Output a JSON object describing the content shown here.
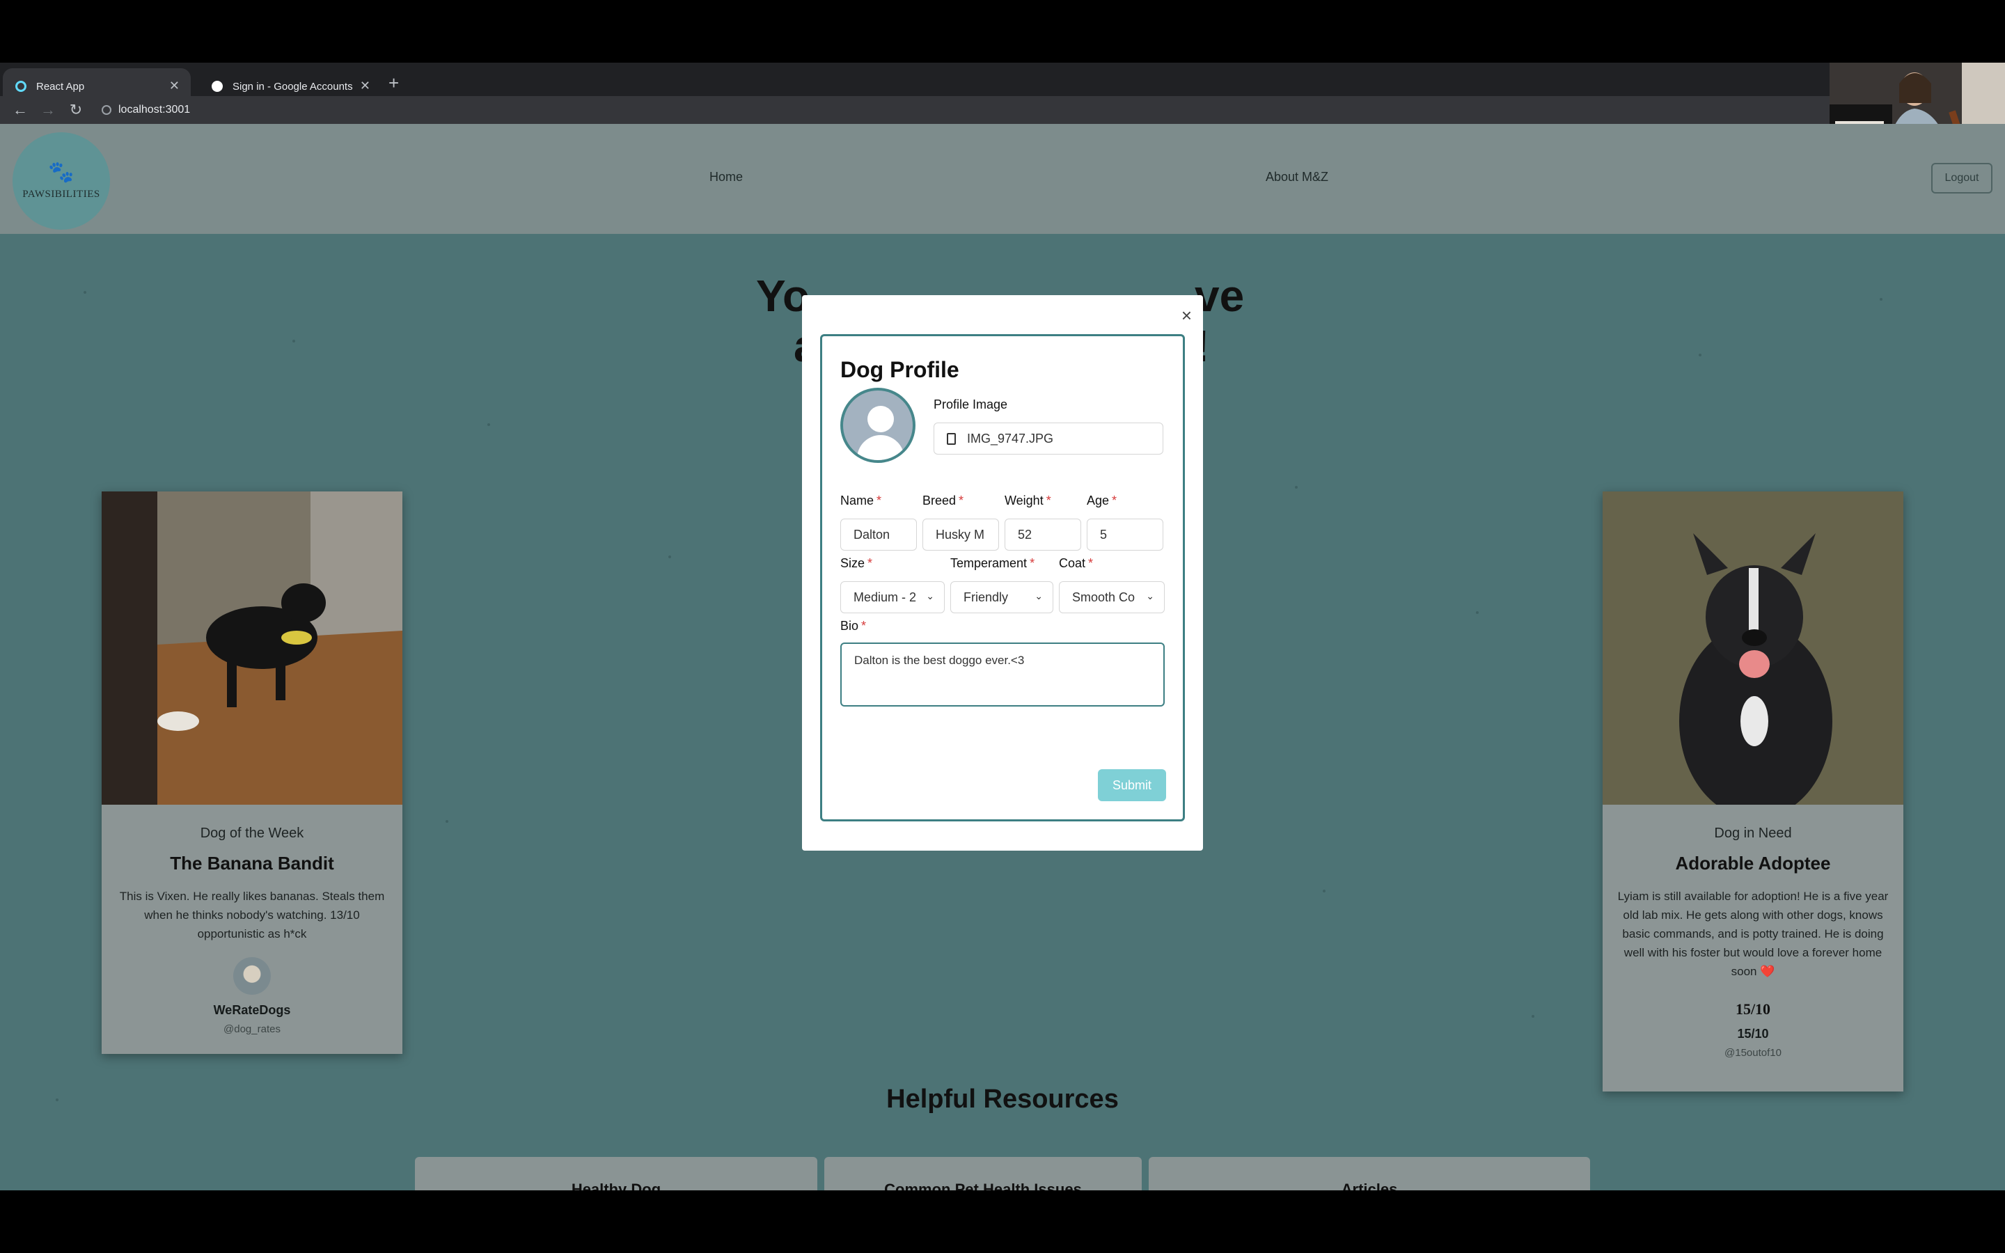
{
  "browser": {
    "tabs": [
      {
        "title": "React App",
        "favicon_color": "#61dafb"
      },
      {
        "title": "Sign in - Google Accounts",
        "favicon_color": "#ffffff"
      }
    ],
    "new_tab": "+",
    "back": "←",
    "forward": "→",
    "reload": "↻",
    "url": "localhost:3001"
  },
  "nav": {
    "logo_text": "PAWSIBILITIES",
    "logo_paw": "🐾",
    "links": [
      "Home",
      "About M&Z"
    ],
    "logout": "Logout"
  },
  "hero": {
    "fragment_l1": "Yo",
    "fragment_r1": "ve",
    "fragment_l2": "a",
    "fragment_r2": "!"
  },
  "dog_of_week": {
    "kicker": "Dog of the Week",
    "title": "The Banana Bandit",
    "body": "This is Vixen. He really likes bananas. Steals them when he thinks nobody's watching. 13/10 opportunistic as h*ck",
    "author": "WeRateDogs",
    "handle": "@dog_rates"
  },
  "dog_in_need": {
    "kicker": "Dog in Need",
    "title": "Adorable Adoptee",
    "body": "Lyiam is still available for adoption! He is a five year old lab mix. He gets along with other dogs, knows basic commands, and is potty trained. He is doing well with his foster but would love a forever home soon ❤️",
    "logo": "15/10",
    "author": "15/10",
    "handle": "@15outof10"
  },
  "resources": {
    "title": "Helpful Resources",
    "cards": [
      "Healthy Dog",
      "Common Pet Health Issues",
      "Articles"
    ]
  },
  "modal": {
    "close": "×",
    "title": "Dog Profile",
    "profile_image_label": "Profile Image",
    "file_name": "IMG_9747.JPG",
    "required_mark": "*",
    "fields": {
      "name": {
        "label": "Name",
        "value": "Dalton"
      },
      "breed": {
        "label": "Breed",
        "value": "Husky M"
      },
      "weight": {
        "label": "Weight",
        "value": "52"
      },
      "age": {
        "label": "Age",
        "value": "5"
      },
      "size": {
        "label": "Size",
        "value": "Medium - 2"
      },
      "temperament": {
        "label": "Temperament",
        "value": "Friendly"
      },
      "coat": {
        "label": "Coat",
        "value": "Smooth Co"
      },
      "bio": {
        "label": "Bio",
        "value": "Dalton is the best doggo ever.<3"
      }
    },
    "submit": "Submit"
  },
  "colors": {
    "accent": "#3d7f83",
    "submit": "#7fd0d6",
    "required": "#d63b3b"
  }
}
